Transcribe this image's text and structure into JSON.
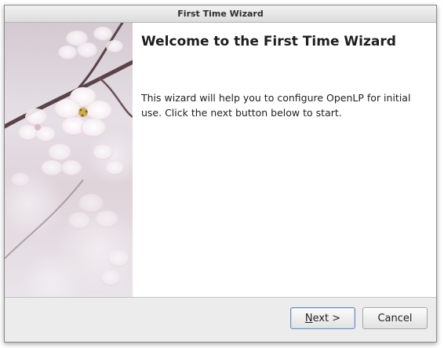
{
  "window": {
    "title": "First Time Wizard"
  },
  "page": {
    "heading": "Welcome to the First Time Wizard",
    "body": "This wizard will help you to configure OpenLP for initial use. Click the next button below to start."
  },
  "buttons": {
    "next_mnemonic": "N",
    "next_rest": "ext >",
    "cancel": "Cancel"
  },
  "colors": {
    "blossom": "#f7f1f4",
    "branch": "#5a4347",
    "stamen": "#c9a23a",
    "background": "#ded4da"
  }
}
